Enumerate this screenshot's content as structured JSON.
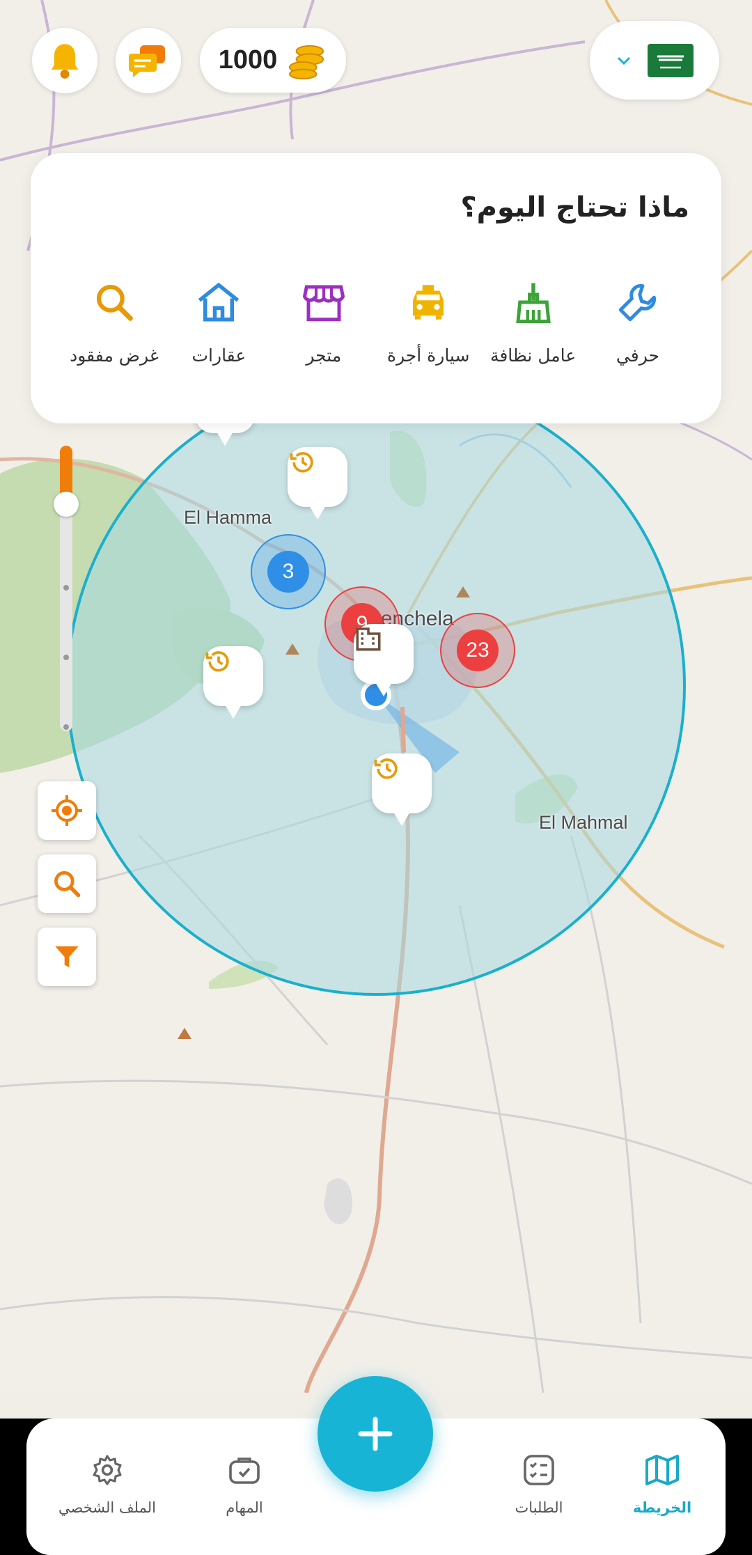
{
  "top_bar": {
    "coins": "1000",
    "icons": {
      "notifications": "bell-icon",
      "messages": "chat-icon",
      "coins": "coins-icon",
      "language": "saudi-flag-icon"
    }
  },
  "services_card": {
    "title": "ماذا تحتاج اليوم؟",
    "items": [
      {
        "label": "حرفي",
        "icon": "wrench-icon",
        "color": "#2f8be0"
      },
      {
        "label": "عامل نظافة",
        "icon": "broom-icon",
        "color": "#3ea33a"
      },
      {
        "label": "سيارة أجرة",
        "icon": "taxi-icon",
        "color": "#f0b400"
      },
      {
        "label": "متجر",
        "icon": "store-icon",
        "color": "#9b30c0"
      },
      {
        "label": "عقارات",
        "icon": "house-icon",
        "color": "#2f8be0"
      },
      {
        "label": "غرض مفقود",
        "icon": "search-icon",
        "color": "#e79a08"
      }
    ]
  },
  "map": {
    "labels": {
      "city1": "El Hamma",
      "city2": "Khenchela",
      "city3": "El Mahmal"
    },
    "clusters": [
      {
        "count": "3",
        "color": "#2f8fe6"
      },
      {
        "count": "9",
        "color": "#ec3f3f"
      },
      {
        "count": "23",
        "color": "#ec3f3f"
      }
    ],
    "zoom_level": 0.16
  },
  "map_controls": {
    "locate": "crosshair-icon",
    "search": "search-icon",
    "filter": "filter-icon"
  },
  "bottom_nav": {
    "items": [
      {
        "label": "الخريطة",
        "icon": "map-icon",
        "active": true
      },
      {
        "label": "الطلبات",
        "icon": "checklist-icon",
        "active": false
      },
      {
        "label": "المهام",
        "icon": "briefcase-icon",
        "active": false
      },
      {
        "label": "الملف الشخصي",
        "icon": "gear-icon",
        "active": false
      }
    ],
    "fab_icon": "plus-icon"
  },
  "colors": {
    "accent": "#17b4d6",
    "orange": "#f07d0a",
    "radius_fill": "#bfe3e8",
    "radius_stroke": "#1ab0cc"
  }
}
